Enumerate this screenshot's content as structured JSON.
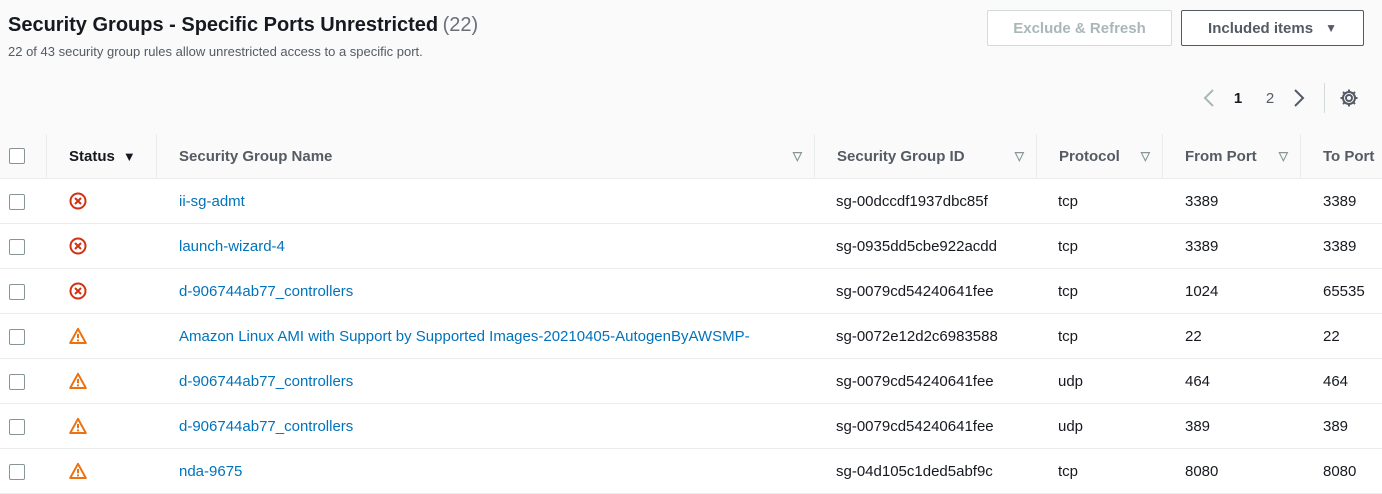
{
  "header": {
    "title": "Security Groups - Specific Ports Unrestricted",
    "count": "(22)",
    "subtitle": "22 of 43 security group rules allow unrestricted access to a specific port."
  },
  "actions": {
    "exclude_refresh": "Exclude & Refresh",
    "included_items": "Included items"
  },
  "pagination": {
    "pages": [
      "1",
      "2"
    ],
    "current": "1"
  },
  "colors": {
    "error": "#d13212",
    "warning": "#ec7211",
    "link": "#0073bb"
  },
  "table": {
    "columns": [
      "Status",
      "Security Group Name",
      "Security Group ID",
      "Protocol",
      "From Port",
      "To Port"
    ],
    "rows": [
      {
        "status": "error",
        "name": "ii-sg-admt",
        "id": "sg-00dccdf1937dbc85f",
        "protocol": "tcp",
        "from": "3389",
        "to": "3389"
      },
      {
        "status": "error",
        "name": "launch-wizard-4",
        "id": "sg-0935dd5cbe922acdd",
        "protocol": "tcp",
        "from": "3389",
        "to": "3389"
      },
      {
        "status": "error",
        "name": "d-906744ab77_controllers",
        "id": "sg-0079cd54240641fee",
        "protocol": "tcp",
        "from": "1024",
        "to": "65535"
      },
      {
        "status": "warning",
        "name": "Amazon Linux AMI with Support by Supported Images-20210405-AutogenByAWSMP-",
        "id": "sg-0072e12d2c6983588",
        "protocol": "tcp",
        "from": "22",
        "to": "22"
      },
      {
        "status": "warning",
        "name": "d-906744ab77_controllers",
        "id": "sg-0079cd54240641fee",
        "protocol": "udp",
        "from": "464",
        "to": "464"
      },
      {
        "status": "warning",
        "name": "d-906744ab77_controllers",
        "id": "sg-0079cd54240641fee",
        "protocol": "udp",
        "from": "389",
        "to": "389"
      },
      {
        "status": "warning",
        "name": "nda-9675",
        "id": "sg-04d105c1ded5abf9c",
        "protocol": "tcp",
        "from": "8080",
        "to": "8080"
      }
    ]
  }
}
